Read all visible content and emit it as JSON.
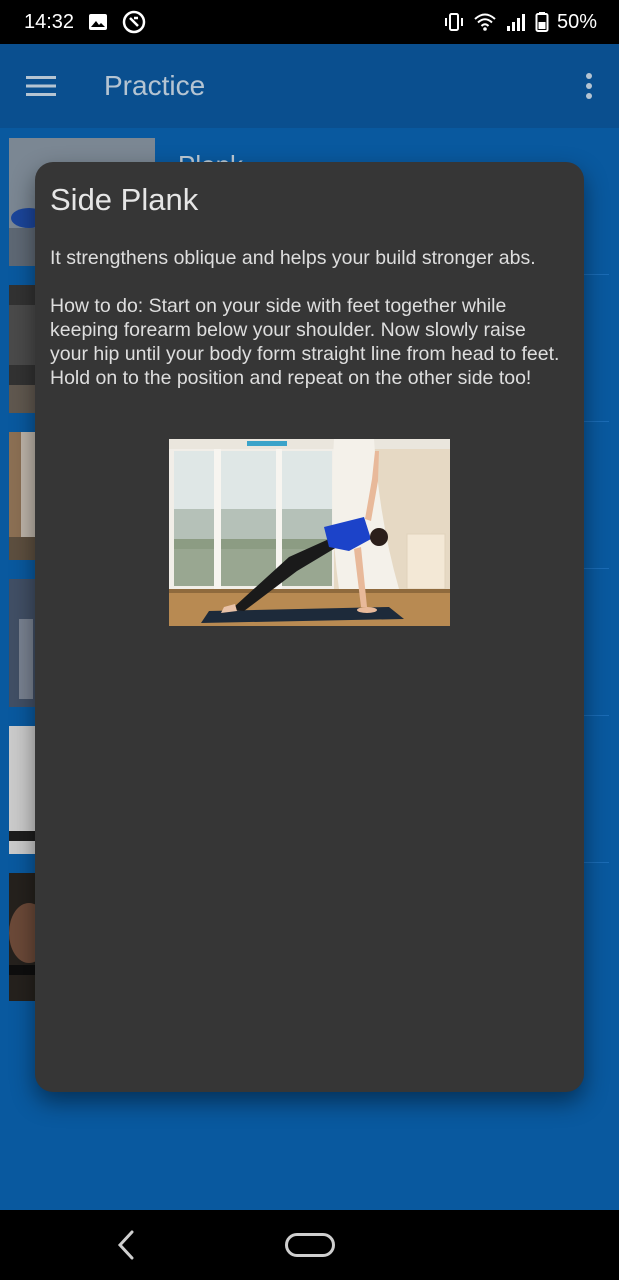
{
  "status_bar": {
    "time": "14:32",
    "battery": "50%",
    "icons_left": [
      "image-icon",
      "sync-circle-icon"
    ],
    "icons_right": [
      "vibrate-icon",
      "wifi-icon",
      "signal-icon",
      "battery-icon"
    ]
  },
  "app_bar": {
    "title": "Practice",
    "color": "#0c5ba3"
  },
  "list": {
    "items": [
      {
        "label": "Plank"
      },
      {
        "label": ""
      },
      {
        "label": ""
      },
      {
        "label": ""
      },
      {
        "label": ""
      },
      {
        "label": ""
      }
    ]
  },
  "dialog": {
    "title": "Side Plank",
    "description": "It strengthens oblique and helps your build stronger abs.",
    "how_to": "How to do: Start on your side with feet together while keeping forearm below your shoulder. Now slowly raise your hip until your body form straight line from head to feet. Hold on to the position and repeat on the other side too!",
    "background": "#363636"
  },
  "colors": {
    "accent": "#0b66b5",
    "app_bar": "#0c5ba3"
  }
}
